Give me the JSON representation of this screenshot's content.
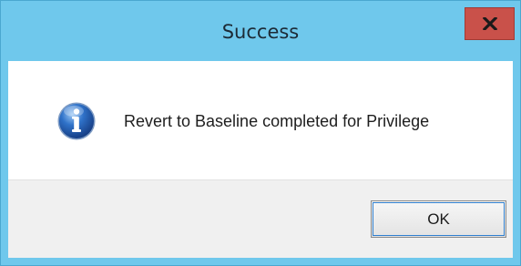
{
  "window": {
    "title": "Success",
    "close_icon": "close-icon",
    "accent_color": "#6fc8ec",
    "close_color": "#c9514a"
  },
  "dialog": {
    "icon": "info-icon",
    "message": "Revert to Baseline completed for Privilege",
    "ok_label": "OK"
  }
}
